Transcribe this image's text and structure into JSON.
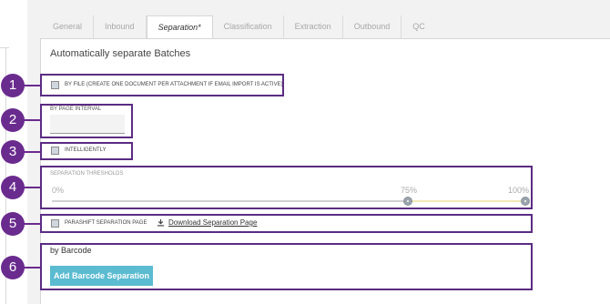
{
  "tabs": [
    {
      "label": "General"
    },
    {
      "label": "Inbound"
    },
    {
      "label": "Separation*"
    },
    {
      "label": "Classification"
    },
    {
      "label": "Extraction"
    },
    {
      "label": "Outbound"
    },
    {
      "label": "QC"
    }
  ],
  "active_tab": "Separation*",
  "section_title": "Automatically separate Batches",
  "by_file": {
    "label": "BY FILE (CREATE ONE DOCUMENT PER ATTACHMENT IF EMAIL IMPORT IS ACTIVE)",
    "checked": false
  },
  "by_page_interval": {
    "label": "BY PAGE INTERVAL",
    "value": ""
  },
  "intelligently": {
    "label": "INTELLIGENTLY",
    "checked": false
  },
  "thresholds": {
    "label": "SEPARATION THRESHOLDS",
    "min_label": "0%",
    "mid_label": "75%",
    "max_label": "100%",
    "lower_value": 75,
    "upper_value": 100
  },
  "parashift": {
    "label": "PARASHIFT SEPARATION PAGE",
    "checked": false,
    "download_link": "Download Separation Page"
  },
  "barcode": {
    "title": "by Barcode",
    "button_label": "Add Barcode Separation"
  },
  "badges": [
    "1",
    "2",
    "3",
    "4",
    "5",
    "6"
  ],
  "colors": {
    "highlight": "#5b2c83",
    "badge": "#6a2b8e",
    "button": "#5bbbd0"
  }
}
